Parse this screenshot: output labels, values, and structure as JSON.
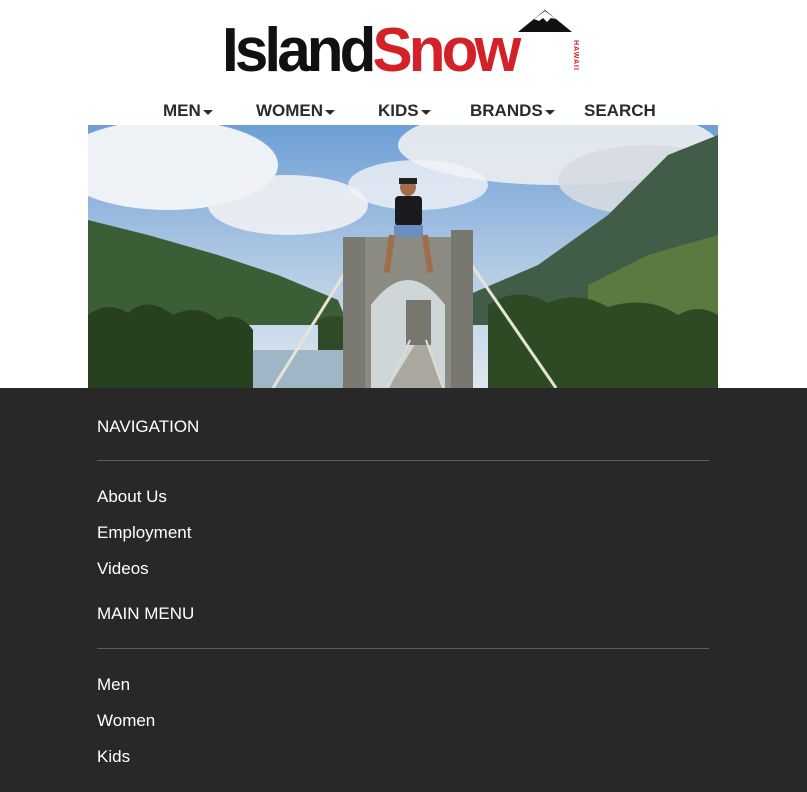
{
  "logo": {
    "island": "Island",
    "snow": "Snow",
    "hawaii": "HAWAII",
    "brand_red": "#d42027",
    "brand_black": "#111111"
  },
  "nav": {
    "items": [
      {
        "label": "MEN",
        "has_dropdown": true,
        "icon": "caret-down-icon"
      },
      {
        "label": "WOMEN",
        "has_dropdown": true,
        "icon": "caret-down-icon"
      },
      {
        "label": "KIDS",
        "has_dropdown": true,
        "icon": "caret-down-icon"
      },
      {
        "label": "BRANDS",
        "has_dropdown": true,
        "icon": "caret-down-icon"
      },
      {
        "label": "SEARCH",
        "has_dropdown": false
      }
    ]
  },
  "hero": {
    "icon": "hero-photo-man-on-bridge-tower"
  },
  "footer": {
    "background": "#282828",
    "sections": [
      {
        "heading": "NAVIGATION",
        "links": [
          "About Us",
          "Employment",
          "Videos"
        ]
      },
      {
        "heading": "MAIN MENU",
        "links": [
          "Men",
          "Women",
          "Kids"
        ]
      }
    ]
  }
}
